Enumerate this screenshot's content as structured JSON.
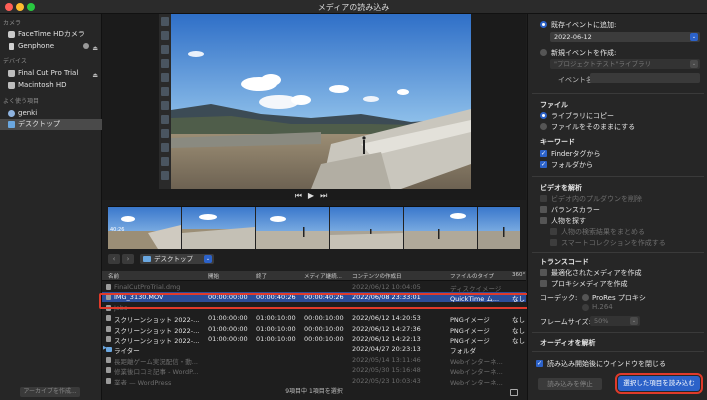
{
  "window": {
    "title": "メディアの読み込み",
    "traffic_colors": [
      "#ff5f57",
      "#febc2e",
      "#28c840"
    ]
  },
  "sidebar": {
    "camera_header": "カメラ",
    "cameras": [
      "FaceTime HDカメラ",
      "Genphone"
    ],
    "devices_header": "デバイス",
    "devices": [
      "Final Cut Pro Trial",
      "Macintosh HD"
    ],
    "favorites_header": "よく使う項目",
    "favorites": [
      "genki",
      "デスクトップ"
    ],
    "archive_button": "アーカイブを作成..."
  },
  "browser": {
    "folder": "デスクトップ",
    "columns": [
      "名前",
      "開始",
      "終了",
      "メディア継続...",
      "コンテンツの作成日",
      "ファイルのタイプ",
      "360°"
    ],
    "rows": [
      {
        "name": "FinalCutProTrial.dmg",
        "start": "",
        "end": "",
        "duration": "",
        "created": "2022/06/12 10:04:05",
        "type": "ディスクイメージ",
        "extra": "",
        "state": "dim"
      },
      {
        "name": "IMG_3130.MOV",
        "start": "00:00:00:00",
        "end": "00:00:40:26",
        "duration": "00:00:40:26",
        "created": "2022/06/08 23:33:01",
        "type": "QuickTime ム...",
        "extra": "なし",
        "state": "sel"
      },
      {
        "name": "Jobs",
        "start": "",
        "end": "",
        "duration": "",
        "created": "",
        "type": "",
        "extra": "",
        "state": "dim"
      },
      {
        "name": "スクリーンショット 2022-...",
        "start": "01:00:00:00",
        "end": "01:00:10:00",
        "duration": "00:00:10:00",
        "created": "2022/06/12 14:20:53",
        "type": "PNGイメージ",
        "extra": "なし",
        "state": "norm"
      },
      {
        "name": "スクリーンショット 2022-...",
        "start": "01:00:00:00",
        "end": "01:00:10:00",
        "duration": "00:00:10:00",
        "created": "2022/06/12 14:27:36",
        "type": "PNGイメージ",
        "extra": "なし",
        "state": "norm"
      },
      {
        "name": "スクリーンショット 2022-...",
        "start": "01:00:00:00",
        "end": "01:00:10:00",
        "duration": "00:00:10:00",
        "created": "2022/06/12 14:22:13",
        "type": "PNGイメージ",
        "extra": "なし",
        "state": "norm"
      },
      {
        "name": "ライター",
        "start": "",
        "end": "",
        "duration": "",
        "created": "2022/04/27 20:23:13",
        "type": "フォルダ",
        "extra": "",
        "state": "folder"
      },
      {
        "name": "長距離ゲーム実況配信・動...",
        "start": "",
        "end": "",
        "duration": "",
        "created": "2022/05/14 13:11:46",
        "type": "Webインターネ...",
        "extra": "",
        "state": "dim"
      },
      {
        "name": "修業後口コミ記事 - WordP...",
        "start": "",
        "end": "",
        "duration": "",
        "created": "2022/05/30 15:16:48",
        "type": "Webインターネ...",
        "extra": "",
        "state": "dim"
      },
      {
        "name": "業者 — WordPress",
        "start": "",
        "end": "",
        "duration": "",
        "created": "2022/05/23 10:03:43",
        "type": "Webインターネ...",
        "extra": "",
        "state": "dim"
      }
    ],
    "status": "9項目中 1項目を選択",
    "thumb_timecode": "40:26"
  },
  "options": {
    "add_existing_event": "既存イベントに追加:",
    "existing_event_value": "2022-06-12",
    "new_event": "新規イベントを作成:",
    "new_event_library": "\"プロジェクトテスト\"ライブラリ",
    "event_name_label": "イベント名:",
    "files_header": "ファイル",
    "copy_to_library": "ライブラリにコピー",
    "leave_in_place": "ファイルをそのままにする",
    "keywords_header": "キーワード",
    "finder_tags": "Finderタグから",
    "from_folders": "フォルダから",
    "video_analysis_header": "ビデオを解析",
    "remove_pulldown": "ビデオ内のプルダウンを削除",
    "balance_color": "バランスカラー",
    "find_people": "人物を探す",
    "consolidate_people": "人物の検索結果をまとめる",
    "smart_collections": "スマートコレクションを作成する",
    "transcode_header": "トランスコード",
    "optimized_media": "最適化されたメディアを作成",
    "proxy_media": "プロキシメディアを作成",
    "codec_label": "コーデック:",
    "codec_value": "ProRes プロキシ",
    "codec_h264": "H.264",
    "frame_size_label": "フレームサイズ:",
    "frame_size_value": "50%",
    "audio_header": "オーディオを解析",
    "close_on_import": "読み込み開始後にウインドウを閉じる",
    "stop_button": "読み込みを停止",
    "import_button": "選択した項目を読み込む"
  }
}
